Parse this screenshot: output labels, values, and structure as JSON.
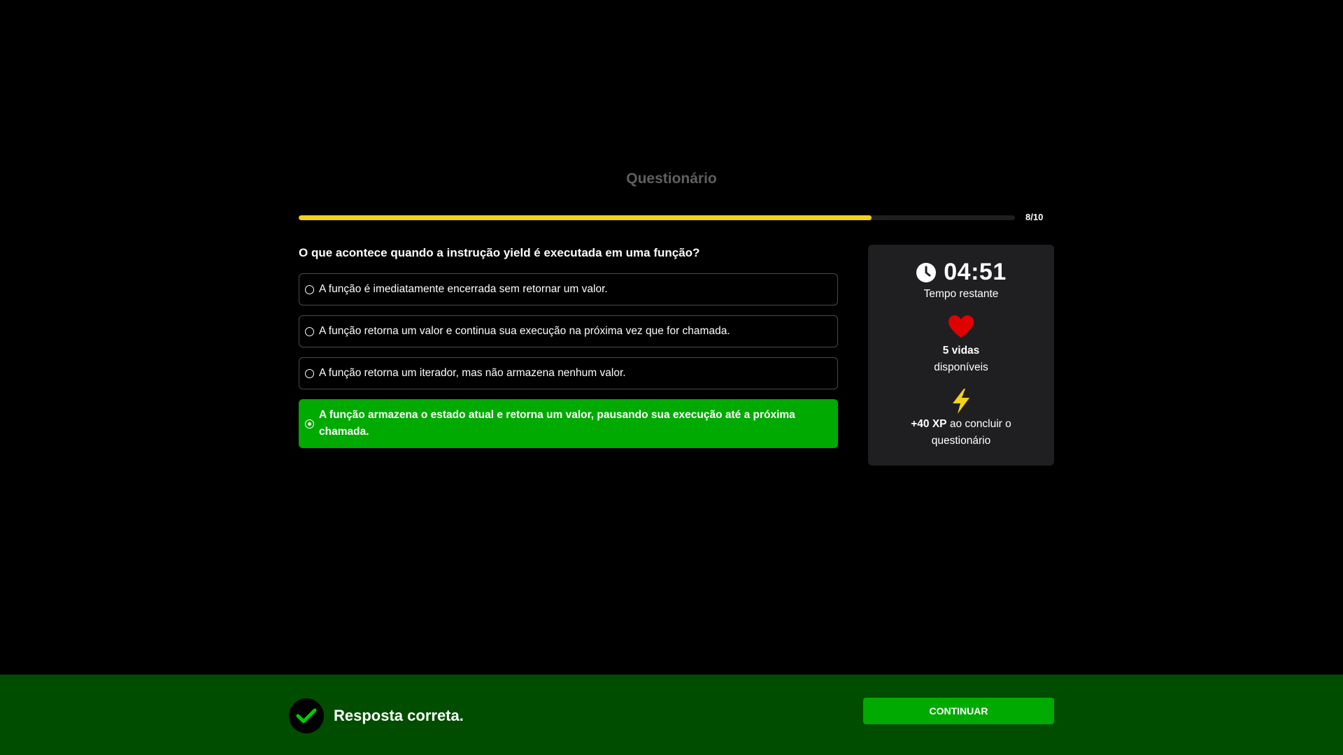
{
  "header": {
    "title": "Questionário"
  },
  "progress": {
    "current": 8,
    "total": 10,
    "fraction": 0.8,
    "label": "8/10",
    "color": "#f2d21b"
  },
  "question": {
    "text": "O que acontece quando a instrução yield é executada em uma função?",
    "options": [
      {
        "label": "A função é imediatamente encerrada sem retornar um valor.",
        "selected": false
      },
      {
        "label": "A função retorna um valor e continua sua execução na próxima vez que for chamada.",
        "selected": false
      },
      {
        "label": "A função retorna um iterador, mas não armazena nenhum valor.",
        "selected": false
      },
      {
        "label": "A função armazena o estado atual e retorna um valor, pausando sua execução até a próxima chamada.",
        "selected": true
      }
    ]
  },
  "sidebar": {
    "timer": {
      "icon": "clock-icon",
      "value": "04:51",
      "label": "Tempo restante"
    },
    "lives": {
      "icon": "heart-icon",
      "count_text": "5 vidas",
      "label": "disponíveis",
      "color": "#e00000"
    },
    "xp": {
      "icon": "lightning-bolt-icon",
      "amount_text": "+40 XP",
      "label": " ao concluir o questionário",
      "color": "#f2d21b"
    }
  },
  "feedback": {
    "icon": "check-icon",
    "message": "Resposta correta.",
    "continue_label": "CONTINUAR",
    "accent_color": "#00aa00",
    "bar_color": "#004d00"
  }
}
